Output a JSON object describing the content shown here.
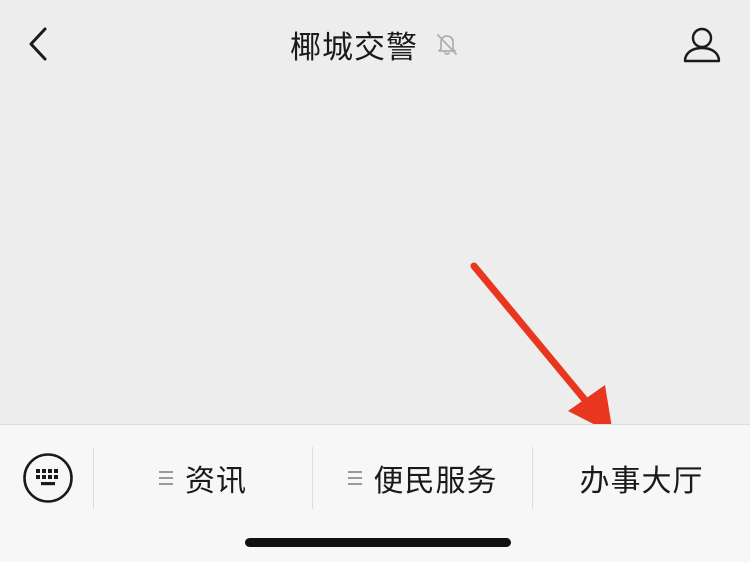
{
  "header": {
    "title": "椰城交警",
    "back_icon": "chevron-left-icon",
    "mute_icon": "bell-off-icon",
    "profile_icon": "person-icon"
  },
  "annotation": {
    "arrow_color": "#e8361f"
  },
  "menu": {
    "keyboard_icon": "keyboard-icon",
    "items": [
      {
        "label": "资讯",
        "has_submenu": true
      },
      {
        "label": "便民服务",
        "has_submenu": true
      },
      {
        "label": "办事大厅",
        "has_submenu": false
      }
    ]
  }
}
